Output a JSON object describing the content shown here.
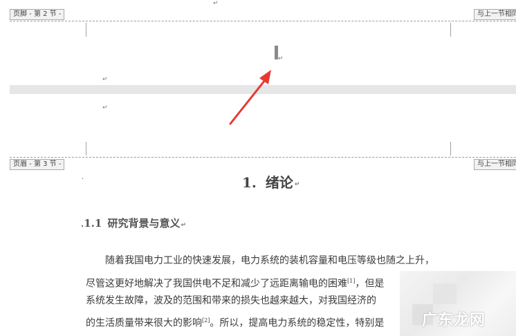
{
  "footer_sec2": {
    "label": "页脚 - 第 2 节 -",
    "link_label": "与上一节相同"
  },
  "header_sec3": {
    "label": "页眉 - 第 3 节 -",
    "link_label": "与上一节相同"
  },
  "paragraph_mark": "↵",
  "heading1": {
    "number": "1.",
    "text": "绪论"
  },
  "heading2": {
    "number": "1.1",
    "text": "研究背景与意义"
  },
  "body_lines": [
    {
      "text": "随着我国电力工业的快速发展，电力系统的装机容量和电压等级也随之上升，",
      "sup": ""
    },
    {
      "text": "尽管这更好地解决了我国供电不足和减少了远距离输电的困难",
      "sup": "[1]",
      "tail": "，但是"
    },
    {
      "text": "系统发生故障，波及的范围和带来的损失也越来越大，对我国经济的",
      "sup": ""
    },
    {
      "text": "的生活质量带来很大的影响",
      "sup": "[2]",
      "tail": "。所以，提高电力系统的稳定性，特别是"
    }
  ],
  "watermark": "广东龙网",
  "colors": {
    "arrow": "#e53935",
    "band": "#e6e6e6",
    "tag_bg": "#f2f2f2",
    "watermark": "#ffffff"
  }
}
